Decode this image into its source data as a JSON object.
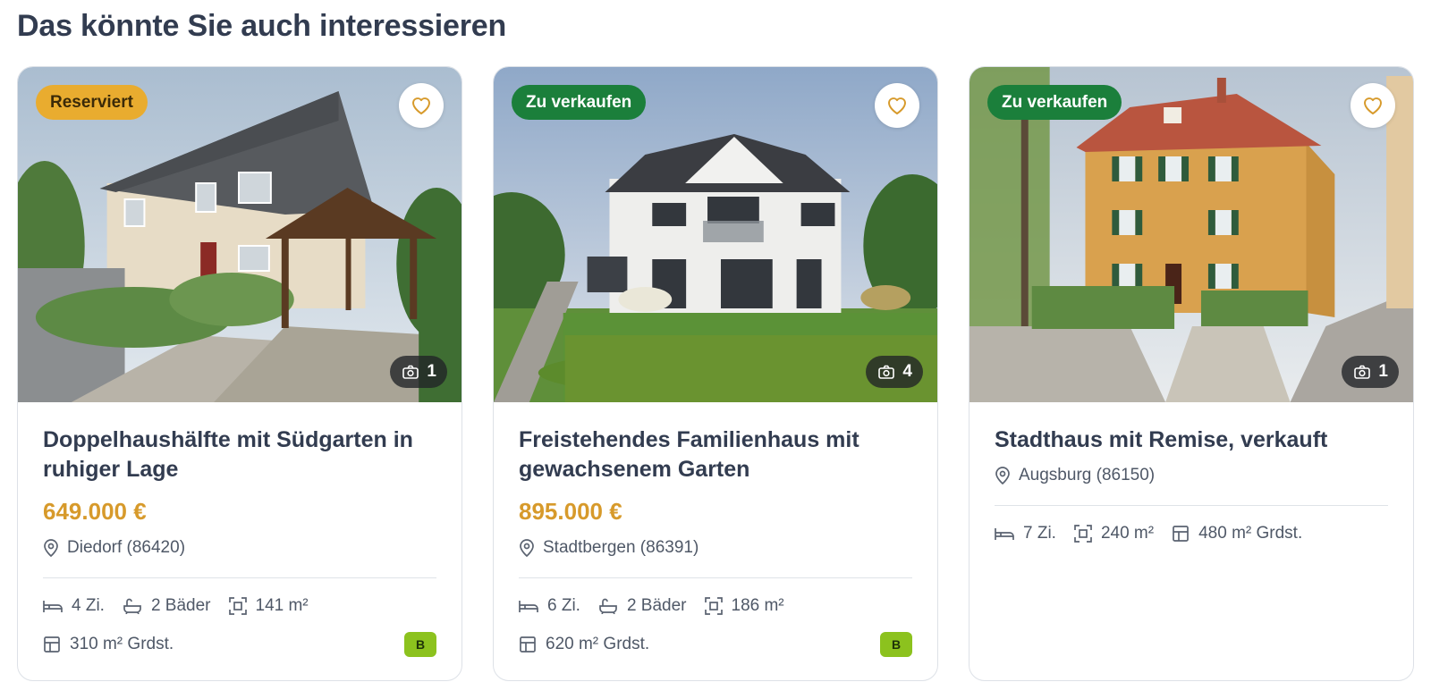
{
  "section": {
    "title": "Das könnte Sie auch interessieren"
  },
  "colors": {
    "accent": "#d79a2b",
    "reserved": "#e9ac2f",
    "for_sale": "#1b7f3b",
    "energy": "#8cc21e",
    "text": "#323c50"
  },
  "icons": {
    "favorite": "heart-icon",
    "photos": "camera-icon",
    "location": "map-pin-icon",
    "rooms": "bed-icon",
    "baths": "bathtub-icon",
    "area": "area-icon",
    "plot": "plot-icon"
  },
  "cards": [
    {
      "status": "Reserviert",
      "photo_count": "1",
      "title": "Doppelhaushälfte mit Südgarten in ruhiger Lage",
      "price": "649.000 €",
      "location": "Diedorf (86420)",
      "rooms": "4 Zi.",
      "baths": "2 Bäder",
      "area": "141 m²",
      "plot": "310 m² Grdst.",
      "energy_class": "B"
    },
    {
      "status": "Zu verkaufen",
      "photo_count": "4",
      "title": "Freistehendes Familienhaus mit gewachsenem Garten",
      "price": "895.000 €",
      "location": "Stadtbergen (86391)",
      "rooms": "6 Zi.",
      "baths": "2 Bäder",
      "area": "186 m²",
      "plot": "620 m² Grdst.",
      "energy_class": "B"
    },
    {
      "status": "Zu verkaufen",
      "photo_count": "1",
      "title": "Stadthaus mit Remise, verkauft",
      "location": "Augsburg (86150)",
      "rooms": "7 Zi.",
      "area": "240 m²",
      "plot": "480 m² Grdst."
    }
  ]
}
